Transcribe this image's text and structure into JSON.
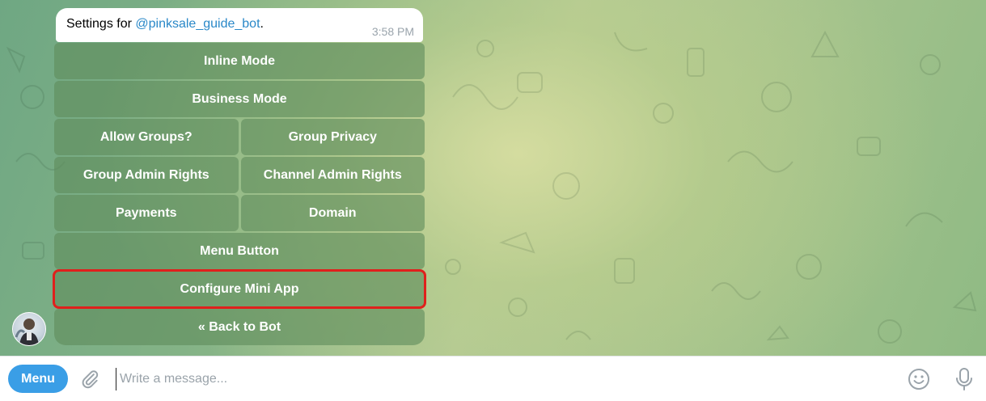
{
  "message": {
    "prefix": "Settings for ",
    "mention": "@pinksale_guide_bot",
    "suffix": ".",
    "time": "3:58 PM"
  },
  "keyboard": {
    "inline_mode": "Inline Mode",
    "business_mode": "Business Mode",
    "allow_groups": "Allow Groups?",
    "group_privacy": "Group Privacy",
    "group_admin_rights": "Group Admin Rights",
    "channel_admin_rights": "Channel Admin Rights",
    "payments": "Payments",
    "domain": "Domain",
    "menu_button": "Menu Button",
    "configure_mini_app": "Configure Mini App",
    "back_to_bot": "« Back to Bot"
  },
  "composer": {
    "menu_label": "Menu",
    "placeholder": "Write a message..."
  },
  "icons": {
    "attach": "paperclip-icon",
    "emoji": "smiley-icon",
    "mic": "microphone-icon"
  },
  "colors": {
    "accent": "#3a9ee6",
    "mention": "#2a88c8",
    "highlight": "#e0201c"
  }
}
